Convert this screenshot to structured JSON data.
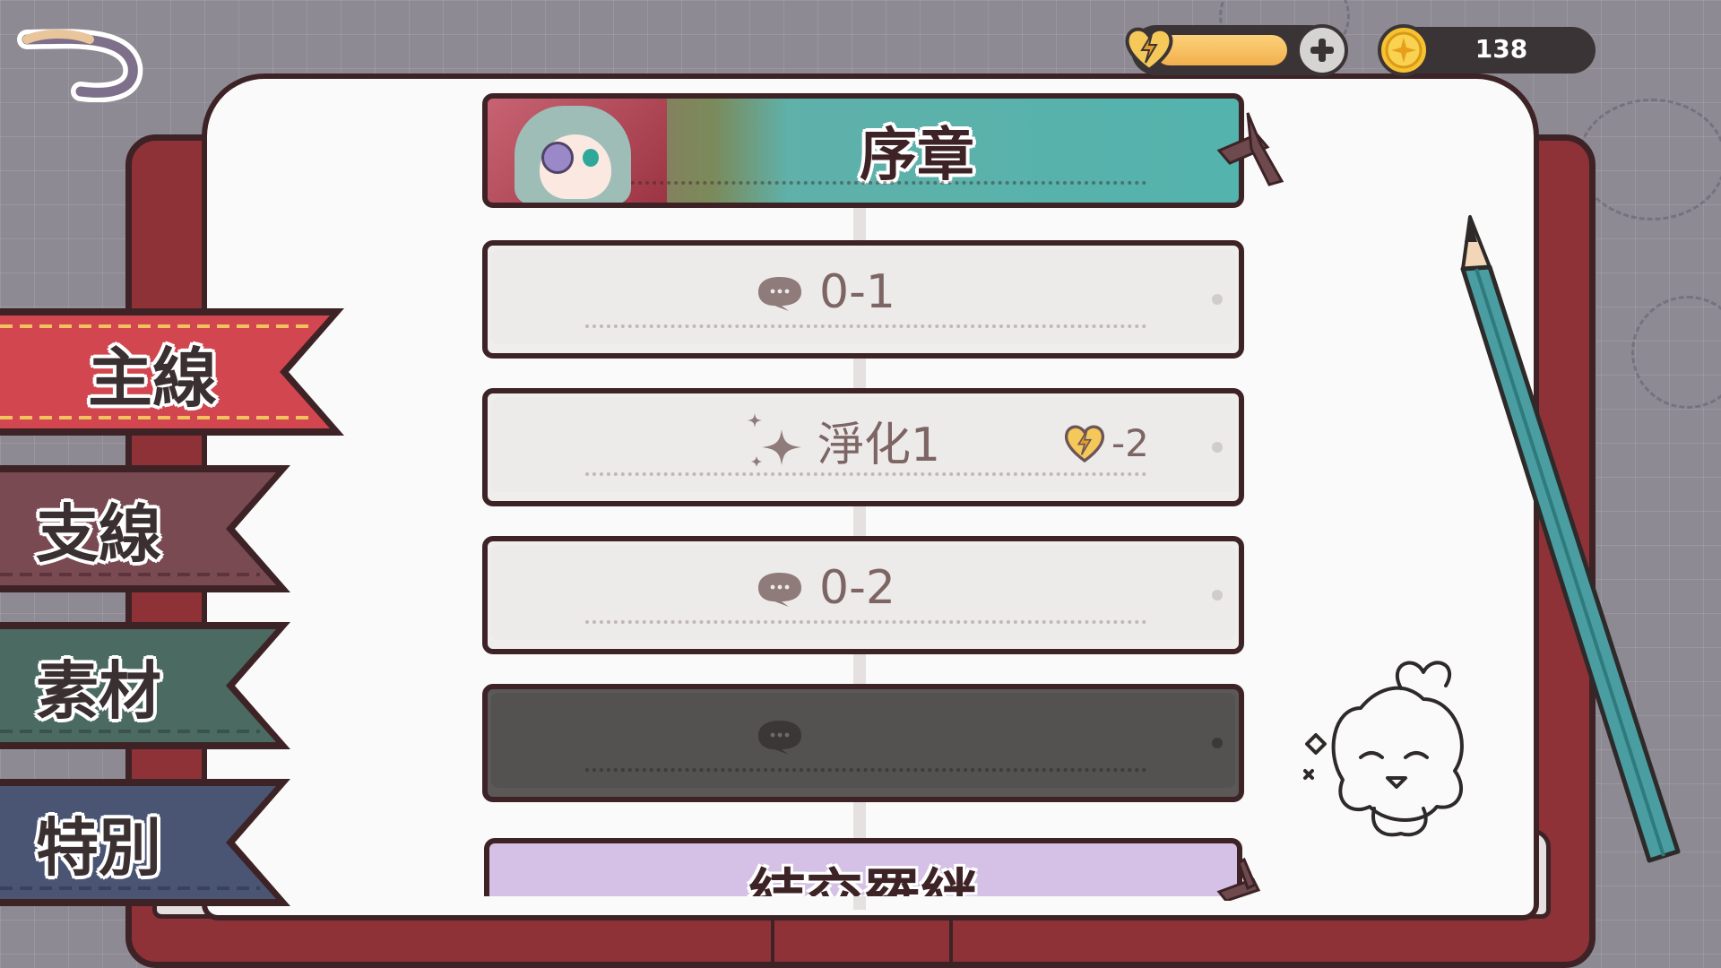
{
  "topbar": {
    "back_icon": "back-arrow-icon",
    "stamina_icon": "lightning-heart-icon",
    "stamina_fill_fraction": 0.78,
    "add_icon": "plus-icon",
    "coin_icon": "gold-coin-icon",
    "coins": "138"
  },
  "tabs": [
    {
      "label": "主線",
      "color": "#d2464f",
      "selected": true
    },
    {
      "label": "支線",
      "color": "#7a4a52",
      "selected": false
    },
    {
      "label": "素材",
      "color": "#4b6a61",
      "selected": false
    },
    {
      "label": "特別",
      "color": "#4a5574",
      "selected": false
    }
  ],
  "chapter": {
    "title": "序章"
  },
  "stages": [
    {
      "label": "0-1",
      "icon": "speech-bubble-icon",
      "locked": false
    },
    {
      "label": "淨化1",
      "icon": "sparkle-icon",
      "locked": false,
      "cost": "-2",
      "cost_icon": "lightning-heart-icon"
    },
    {
      "label": "0-2",
      "icon": "speech-bubble-icon",
      "locked": false
    },
    {
      "label": "",
      "icon": "speech-bubble-icon",
      "locked": true
    }
  ],
  "next_chapter": {
    "title": "結交羅絆"
  }
}
